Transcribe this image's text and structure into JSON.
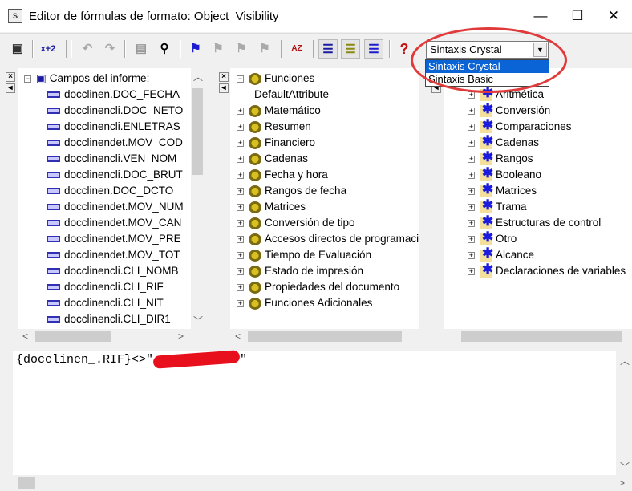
{
  "window": {
    "title": "Editor de fórmulas de formato: Object_Visibility",
    "minimize": "—",
    "maximize": "☐",
    "close": "✕"
  },
  "toolbar": {
    "icons": [
      "save-icon",
      "check-formula-icon",
      "undo-icon",
      "redo-icon",
      "browse-data-icon",
      "find-icon",
      "toggle-bookmark-icon",
      "next-bookmark-icon",
      "previous-bookmark-icon",
      "clear-bookmarks-icon",
      "sort-icon",
      "show-fields-tree-icon",
      "show-functions-tree-icon",
      "show-operators-tree-icon",
      "help-icon"
    ],
    "check_label": "x+2",
    "help_label": "?",
    "sort_label": "AZ",
    "syntax_selected": "Sintaxis Crystal",
    "syntax_options": [
      "Sintaxis Crystal",
      "Sintaxis Basic"
    ]
  },
  "fields_pane": {
    "root": "Campos del informe:",
    "items": [
      "docclinen.DOC_FECHA",
      "docclinencli.DOC_NETO",
      "docclinencli.ENLETRAS",
      "docclinendet.MOV_COD",
      "docclinencli.VEN_NOM",
      "docclinencli.DOC_BRUT",
      "docclinen.DOC_DCTO",
      "docclinendet.MOV_NUM",
      "docclinendet.MOV_CAN",
      "docclinendet.MOV_PRE",
      "docclinendet.MOV_TOT",
      "docclinencli.CLI_NOMB",
      "docclinencli.CLI_RIF",
      "docclinencli.CLI_NIT",
      "docclinencli.CLI_DIR1"
    ]
  },
  "functions_pane": {
    "root": "Funciones",
    "default": "DefaultAttribute",
    "items": [
      "Matemático",
      "Resumen",
      "Financiero",
      "Cadenas",
      "Fecha y hora",
      "Rangos de fecha",
      "Matrices",
      "Conversión de tipo",
      "Accesos directos de programación",
      "Tiempo de Evaluación",
      "Estado de impresión",
      "Propiedades del documento",
      "Funciones Adicionales"
    ]
  },
  "operators_pane": {
    "items": [
      "Aritmética",
      "Conversión",
      "Comparaciones",
      "Cadenas",
      "Rangos",
      "Booleano",
      "Matrices",
      "Trama",
      "Estructuras de control",
      "Otro",
      "Alcance",
      "Declaraciones de variables"
    ]
  },
  "editor": {
    "formula_prefix": "{docclinen_.RIF}<>\"",
    "formula_suffix": "\"",
    "redaction_color": "#e8101c"
  },
  "colors": {
    "selection": "#0a64d6",
    "annotation_ellipse": "#e03a3a"
  }
}
